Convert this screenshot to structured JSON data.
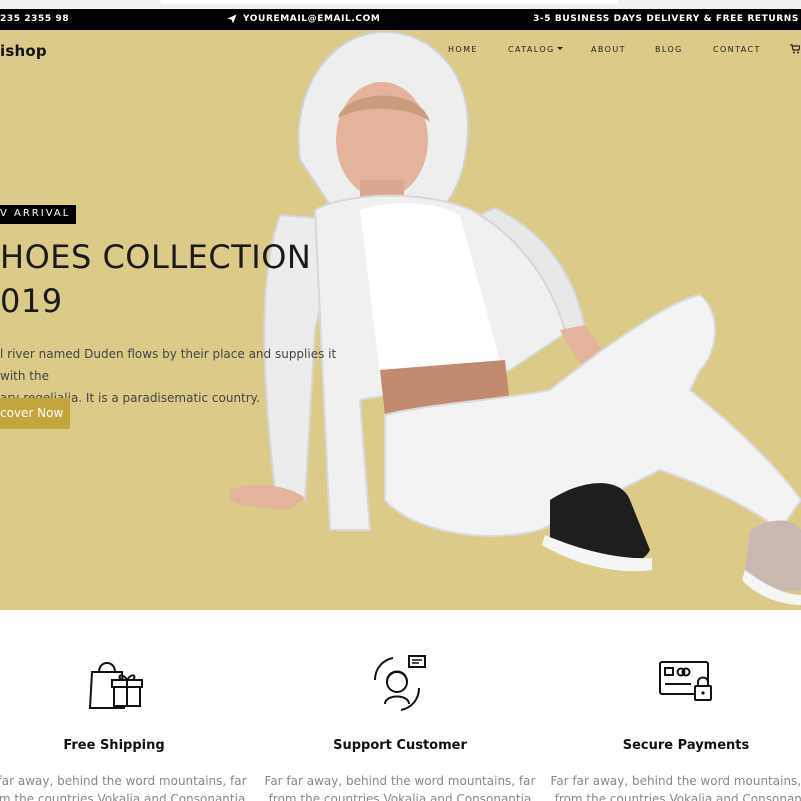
{
  "topbar": {
    "phone": "235 2355 98",
    "email": "YOUREMAIL@EMAIL.COM",
    "delivery": "3-5 BUSINESS DAYS DELIVERY & FREE RETURNS"
  },
  "brand": "ishop",
  "nav": {
    "home": "HOME",
    "catalog": "CATALOG",
    "about": "ABOUT",
    "blog": "BLOG",
    "contact": "CONTACT"
  },
  "hero": {
    "badge": "V ARRIVAL",
    "headline_line1": "HOES COLLECTION",
    "headline_line2": "019",
    "description_line1": "l river named Duden flows by their place and supplies it with the",
    "description_line2": "ary regelialia. It is a paradisematic country.",
    "cta": "cover Now"
  },
  "features": [
    {
      "title": "Free Shipping",
      "icon": "shopping-bag-gift-icon",
      "text_line1": "ar far away, behind the word mountains, far",
      "text_line2": "from the countries Vokalia and Consonantia"
    },
    {
      "title": "Support Customer",
      "icon": "customer-support-icon",
      "text_line1": "Far far away, behind the word mountains, far",
      "text_line2": "from the countries Vokalia and Consonantia"
    },
    {
      "title": "Secure Payments",
      "icon": "credit-card-lock-icon",
      "text_line1": "Far far away, behind the word mountains, far",
      "text_line2": "from the countries Vokalia and Consonantia"
    }
  ],
  "colors": {
    "hero_bg": "#dccb88",
    "accent": "#c2a53d",
    "topbar_bg": "#000000"
  }
}
